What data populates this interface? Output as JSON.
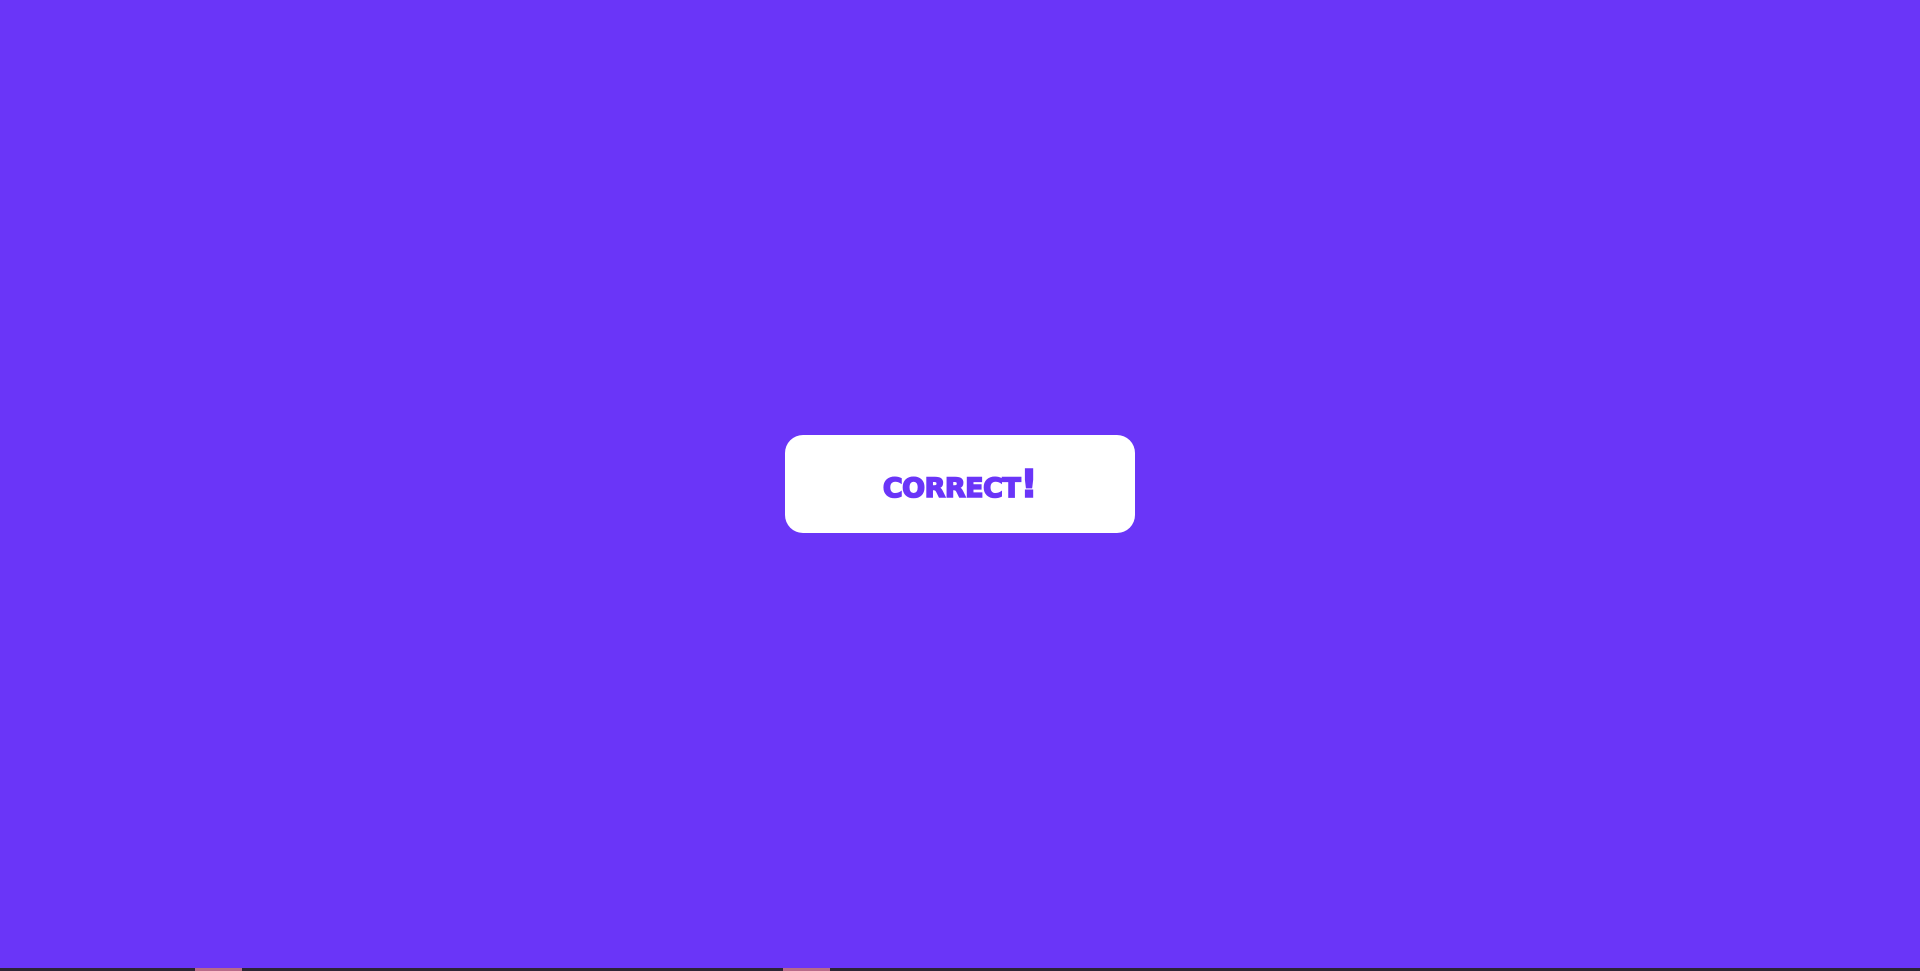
{
  "feedback": {
    "message": "Correct!"
  },
  "colors": {
    "background": "#6a35f8",
    "card": "#ffffff",
    "text": "#6a35f8",
    "bottom_bar": "#2c2535",
    "bottom_marker": "#b86b88"
  }
}
